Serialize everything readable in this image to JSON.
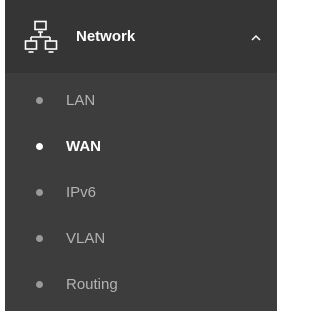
{
  "menu": {
    "title": "Network",
    "icon": "network-icon",
    "expanded": true,
    "toggle_icon": "chevron-up-icon",
    "items": [
      {
        "id": "lan",
        "label": "LAN",
        "active": false
      },
      {
        "id": "wan",
        "label": "WAN",
        "active": true
      },
      {
        "id": "ipv6",
        "label": "IPv6",
        "active": false
      },
      {
        "id": "vlan",
        "label": "VLAN",
        "active": false
      },
      {
        "id": "routing",
        "label": "Routing",
        "active": false
      }
    ]
  },
  "colors": {
    "panel_background": "#3d3d3d",
    "header_background": "#353535",
    "active_text": "#ffffff",
    "inactive_text": "#b3b3b3",
    "inactive_bullet": "#9a9a9a"
  }
}
